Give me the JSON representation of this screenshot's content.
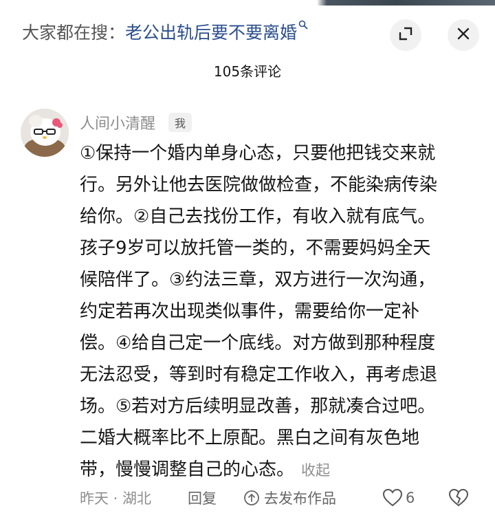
{
  "header": {
    "search_prefix": "大家都在搜：",
    "search_query": "老公出轨后要不要离婚",
    "search_icon": "search-icon",
    "expand_icon": "expand-icon",
    "close_icon": "close-icon"
  },
  "comments_count": "105条评论",
  "comment": {
    "username": "人间小清醒",
    "me_badge": "我",
    "lines": [
      "①保持一个婚内单身心态，只要他把钱交来就",
      "行。另外让他去医院做做检查，不能染病传染",
      "给你。②自己去找份工作，有收入就有底气。",
      "孩子9岁可以放托管一类的，不需要妈妈全天",
      "候陪伴了。③约法三章，双方进行一次沟通，",
      "约定若再次出现类似事件，需要给你一定补",
      "偿。④给自己定一个底线。对方做到那种程度",
      "无法忍受，等到时有稳定工作收入，再考虑退",
      "场。⑤若对方后续明显改善，那就凑合过吧。",
      "二婚大概率比不上原配。黑白之间有灰色地",
      "带，慢慢调整自己的心态。"
    ],
    "collapse_label": "收起",
    "time_location": "昨天 · 湖北",
    "reply_label": "回复",
    "publish_label": "去发布作品",
    "like_count": "6"
  },
  "colors": {
    "search_query": "#2a4e8c",
    "muted": "#8e8e8e",
    "text": "#161616"
  }
}
